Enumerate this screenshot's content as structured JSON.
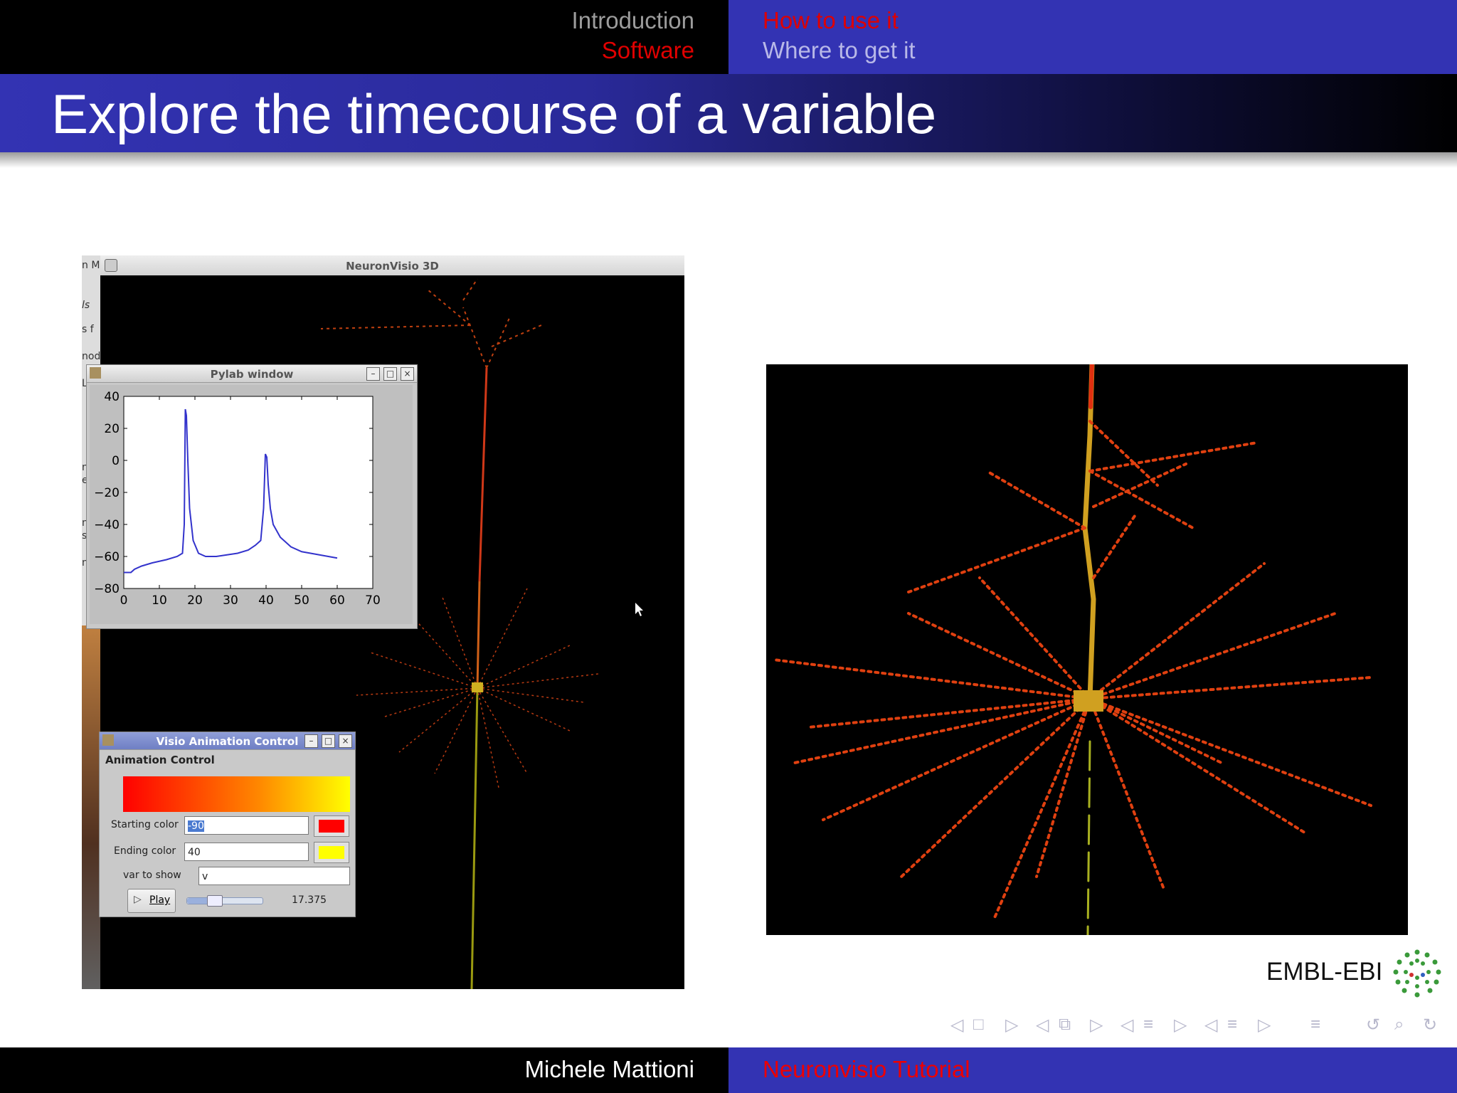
{
  "header": {
    "nav_left": [
      {
        "label": "Introduction",
        "color": "#9c9c9c"
      },
      {
        "label": "Software",
        "color": "#e00000"
      }
    ],
    "nav_right": [
      {
        "label": "How to use it",
        "color": "#e00000"
      },
      {
        "label": "Where to get it",
        "color": "#b8b8e8"
      }
    ]
  },
  "slide": {
    "title": "Explore the timecourse of a variable"
  },
  "screenshot": {
    "left_strip_texts": [
      "n M",
      "ls",
      "s f",
      "nod",
      "L",
      "n",
      "e",
      "n",
      "s",
      "n"
    ],
    "neuronvisio_window_title": "NeuronVisio 3D",
    "pylab_window": {
      "title": "Pylab window",
      "buttons": [
        "minimize-icon",
        "maximize-icon",
        "close-icon"
      ]
    },
    "animation_window": {
      "title": "Visio Animation Control",
      "section_label": "Animation Control",
      "starting_color_label": "Starting color",
      "starting_color_value": "-90",
      "starting_color_swatch": "#ff0000",
      "ending_color_label": "Ending color",
      "ending_color_value": "40",
      "ending_color_swatch": "#ffff00",
      "var_label": "var to show",
      "var_value": "v",
      "play_label": "Play",
      "time_value": "17.375",
      "slider_fraction": 0.3
    }
  },
  "chart_data": {
    "type": "line",
    "title": "",
    "xlabel": "",
    "ylabel": "",
    "xlim": [
      0,
      70
    ],
    "ylim": [
      -80,
      40
    ],
    "xticks": [
      "0",
      "10",
      "20",
      "30",
      "40",
      "50",
      "60",
      "70"
    ],
    "yticks": [
      "40",
      "20",
      "0",
      "−20",
      "−40",
      "−60",
      "−80"
    ],
    "series": [
      {
        "color": "#3333cc",
        "x": [
          0,
          2,
          3,
          5,
          8,
          12,
          15,
          16.5,
          17,
          17.3,
          17.6,
          18,
          18.5,
          19.5,
          21,
          23,
          26,
          29,
          32,
          35,
          37,
          38.5,
          39.3,
          39.8,
          40.2,
          40.6,
          41.2,
          42,
          44,
          47,
          50,
          55,
          60
        ],
        "y": [
          -70,
          -70,
          -68,
          -66,
          -64,
          -62,
          -60,
          -58,
          -40,
          32,
          28,
          0,
          -30,
          -50,
          -58,
          -60,
          -60,
          -59,
          -58,
          -56,
          -53,
          -50,
          -30,
          4,
          2,
          -15,
          -30,
          -40,
          -48,
          -54,
          -57,
          -59,
          -61
        ]
      }
    ]
  },
  "footer": {
    "author": "Michele Mattioni",
    "talk": "Neuronvisio Tutorial",
    "logo_text": "EMBL-EBI"
  },
  "nav_symbols": [
    "◁",
    "□",
    "▷",
    "◁",
    "⧉",
    "▷",
    "◁",
    "≡",
    "▷",
    "◁",
    "≡",
    "▷",
    "≡",
    "↺",
    "⌕",
    "↻"
  ]
}
